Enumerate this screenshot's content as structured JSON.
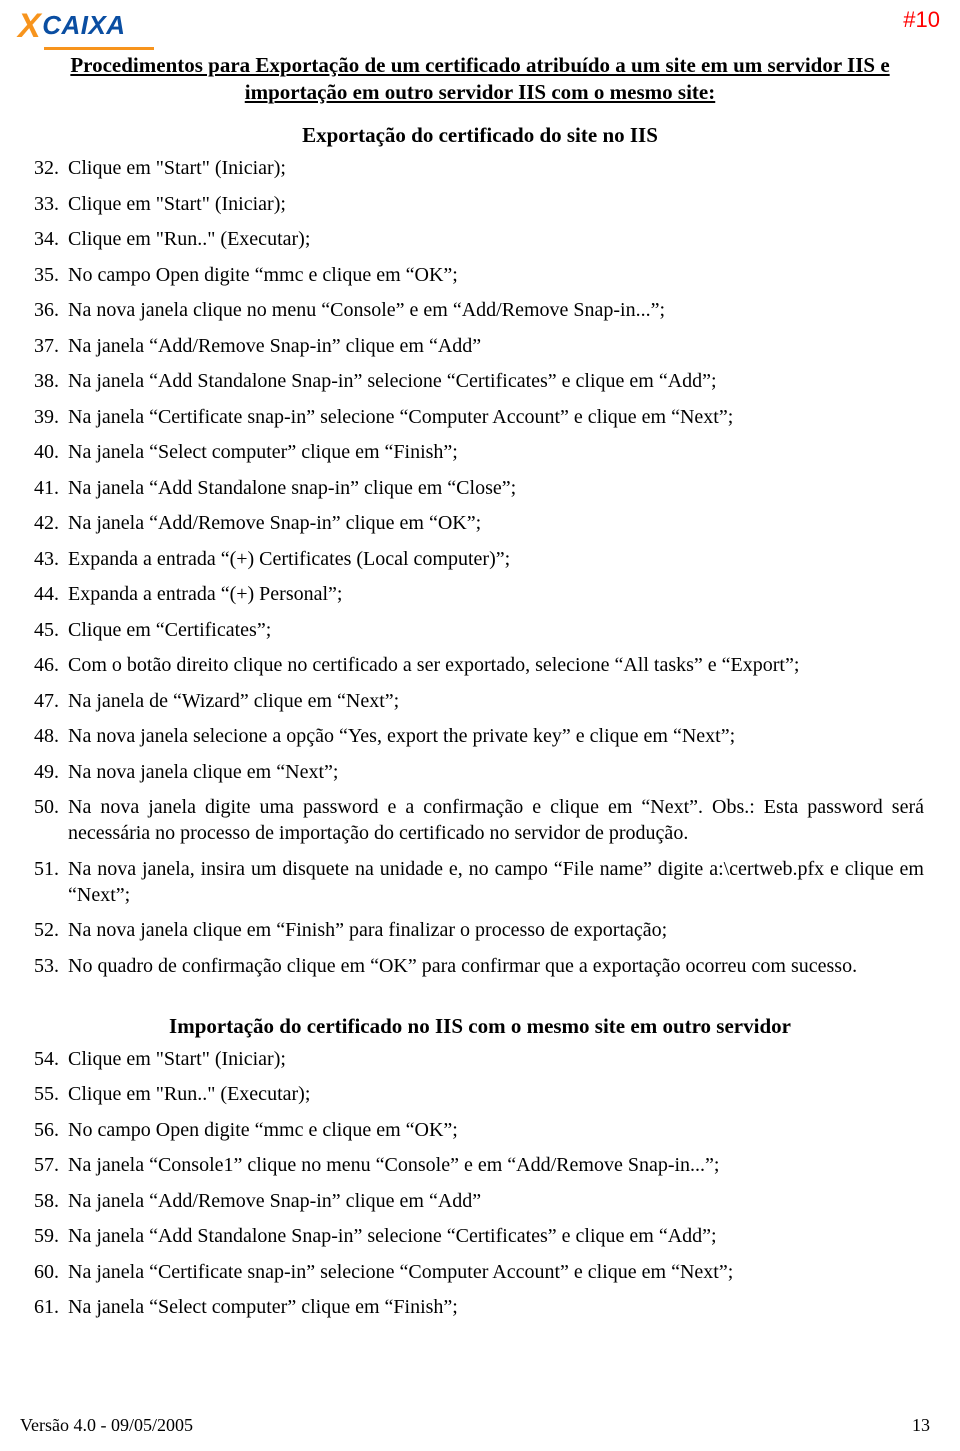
{
  "brand": {
    "x": "X",
    "name": "CAIXA"
  },
  "page_tag": "#10",
  "main_title": "Procedimentos para Exportação de um certificado atribuído a um site em um servidor IIS e importação em outro servidor IIS com o mesmo site:",
  "section_a_title": "Exportação do certificado do site no IIS",
  "steps_a_start": 32,
  "steps_a": [
    "Clique em \"Start\" (Iniciar);",
    "Clique em \"Start\" (Iniciar);",
    "Clique em \"Run..\" (Executar);",
    "No campo Open digite “mmc e clique em “OK”;",
    "Na nova janela clique no menu “Console” e em “Add/Remove Snap-in...”;",
    "Na janela “Add/Remove Snap-in” clique em “Add”",
    "Na janela “Add Standalone Snap-in” selecione “Certificates” e clique em “Add”;",
    "Na janela “Certificate snap-in” selecione “Computer Account” e clique em “Next”;",
    "Na janela “Select computer” clique em “Finish”;",
    "Na janela “Add Standalone snap-in” clique em “Close”;",
    "Na janela “Add/Remove Snap-in” clique em “OK”;",
    "Expanda a entrada “(+) Certificates (Local computer)”;",
    "Expanda a entrada “(+) Personal”;",
    "Clique em “Certificates”;",
    "Com o botão direito clique no certificado a ser exportado, selecione “All tasks” e “Export”;",
    "Na janela de “Wizard” clique em “Next”;",
    "Na nova janela selecione a opção “Yes, export the private key” e clique em “Next”;",
    "Na nova janela clique em “Next”;",
    "Na nova janela digite uma password e a confirmação e clique em “Next”. Obs.: Esta password será necessária no processo de importação do certificado no servidor de produção.",
    "Na nova janela, insira um disquete na unidade e, no campo “File name” digite a:\\certweb.pfx e clique em “Next”;",
    "Na nova janela clique em “Finish” para finalizar o processo de exportação;",
    "No quadro de confirmação clique em “OK” para confirmar que a exportação ocorreu com sucesso."
  ],
  "section_b_title": "Importação do certificado no IIS com o mesmo site em outro servidor",
  "steps_b_start": 54,
  "steps_b": [
    "Clique em \"Start\" (Iniciar);",
    "Clique em \"Run..\" (Executar);",
    "No campo Open digite “mmc e clique em “OK”;",
    "Na janela “Console1” clique no menu “Console” e em “Add/Remove Snap-in...”;",
    "Na janela “Add/Remove Snap-in” clique em “Add”",
    "Na janela “Add Standalone Snap-in” selecione “Certificates” e clique em “Add”;",
    "Na janela “Certificate snap-in” selecione “Computer Account” e clique em “Next”;",
    "Na janela “Select computer” clique em “Finish”;"
  ],
  "footer": {
    "version": "Versão 4.0 - 09/05/2005",
    "page": "13"
  }
}
